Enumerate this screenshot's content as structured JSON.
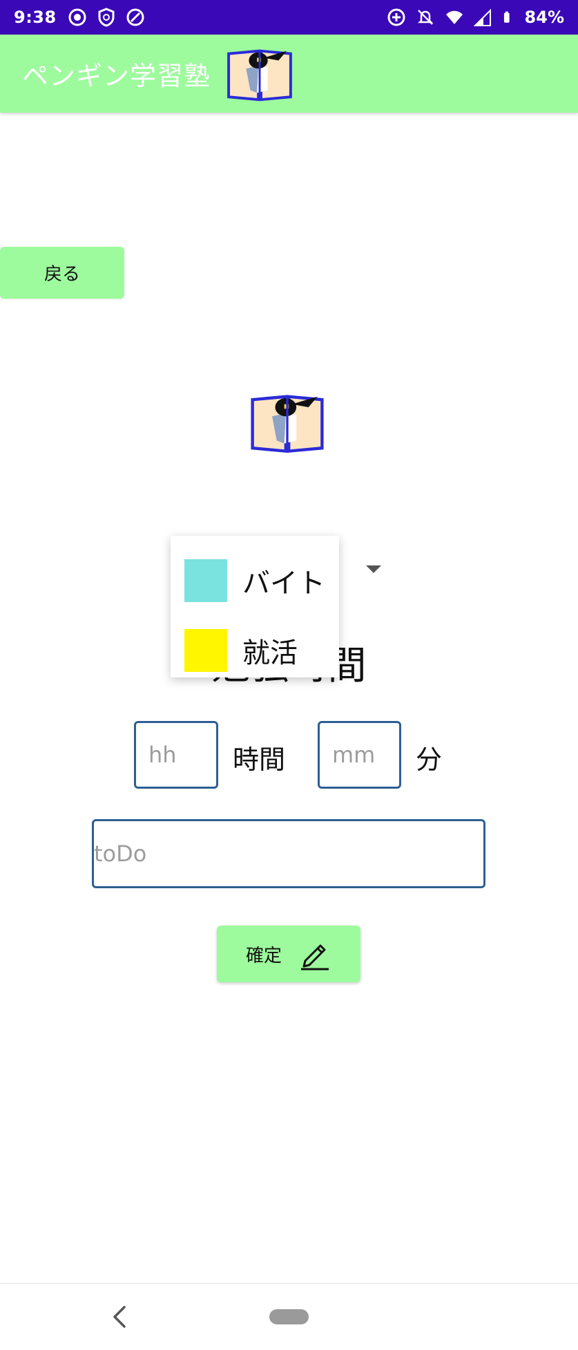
{
  "status_bar": {
    "time": "9:38",
    "battery": "84%",
    "background": "#3a08b7",
    "left_icons": [
      "sync-icon",
      "shield-icon",
      "blocked-icon"
    ],
    "right_icons": [
      "data-saver-icon",
      "mute-icon",
      "wifi-icon",
      "signal-icon",
      "battery-icon"
    ]
  },
  "app_bar": {
    "title": "ペンギン学習塾",
    "background": "#9dfb9d",
    "logo_icon": "penguin-book-icon"
  },
  "back_button": {
    "label": "戻る"
  },
  "center_logo_icon": "penguin-book-icon",
  "subject_title": "勉強時間",
  "dropdown": {
    "items": [
      {
        "label": "バイト",
        "color": "#7ae3df"
      },
      {
        "label": "就活",
        "color": "#fff600"
      }
    ]
  },
  "time_inputs": {
    "hours_placeholder": "hh",
    "hours_unit": "時間",
    "minutes_placeholder": "mm",
    "minutes_unit": "分"
  },
  "todo": {
    "placeholder": "toDo"
  },
  "confirm_button": {
    "label": "確定",
    "icon": "pencil-icon"
  },
  "nav_bar": {
    "icons": [
      "back-chevron-icon",
      "home-pill-icon"
    ]
  }
}
